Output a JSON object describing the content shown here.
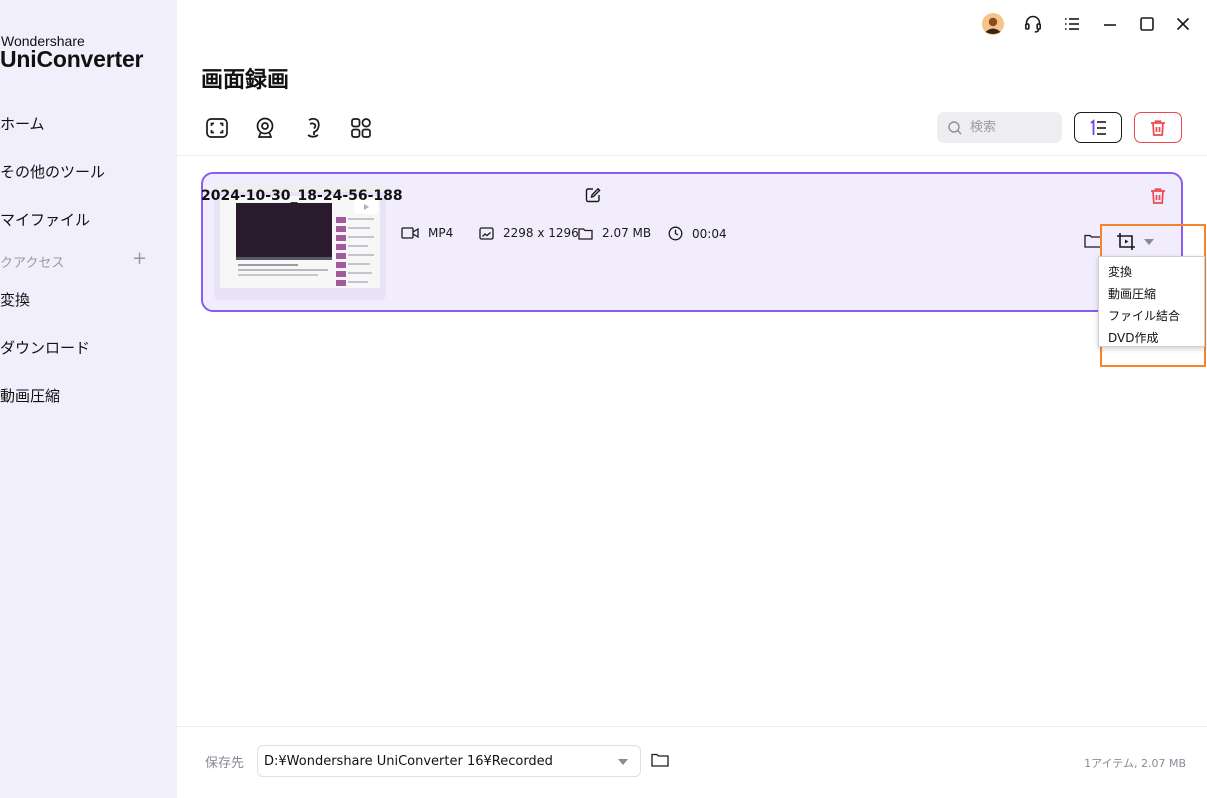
{
  "brand": {
    "top": "Wondershare",
    "main": "UniConverter"
  },
  "sidebar": {
    "items": [
      {
        "label": "ホーム"
      },
      {
        "label": "その他のツール"
      },
      {
        "label": "マイファイル"
      }
    ],
    "quick_access": {
      "label": "クアクセス",
      "add": "+"
    },
    "quick_items": [
      {
        "label": "変換"
      },
      {
        "label": "ダウンロード"
      },
      {
        "label": "動画圧縮"
      }
    ]
  },
  "header": {
    "title": "画面録画",
    "search_placeholder": "検索"
  },
  "recording": {
    "filename": "2024-10-30_18-24-56-188",
    "format": "MP4",
    "resolution": "2298 x 1296",
    "size": "2.07 MB",
    "duration": "00:04"
  },
  "convert_menu": {
    "items": [
      "変換",
      "動画圧縮",
      "ファイル結合",
      "DVD作成"
    ]
  },
  "footer": {
    "save_label": "保存先",
    "save_path": "D:¥Wondershare UniConverter 16¥Recorded",
    "summary": "1アイテム, 2.07 MB"
  },
  "colors": {
    "sidebar_bg": "#f1effb",
    "card_border": "#8a5cf5",
    "card_bg": "#f1edfc",
    "danger": "#f0464f",
    "highlight": "#f5852b"
  }
}
